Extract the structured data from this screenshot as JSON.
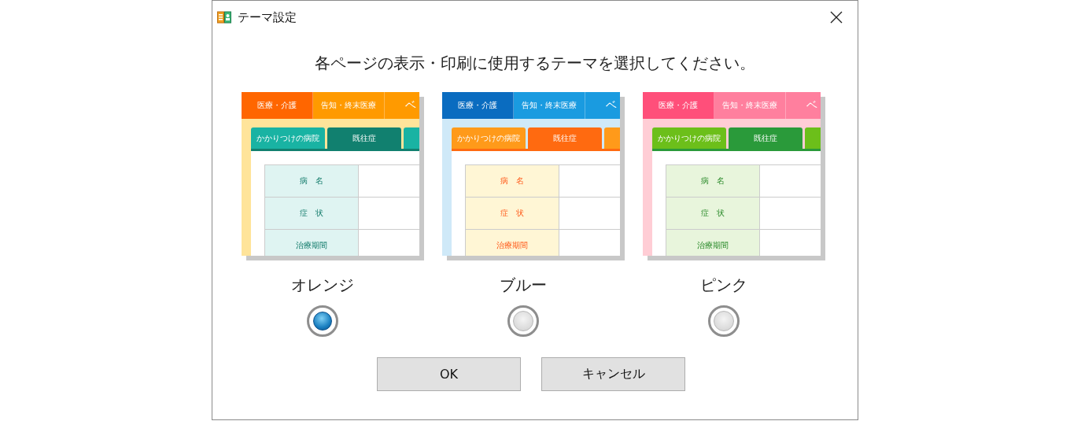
{
  "window": {
    "title": "テーマ設定"
  },
  "message": "各ページの表示・印刷に使用するテーマを選択してください。",
  "themes": [
    {
      "kind": "orange",
      "label": "オレンジ",
      "selected": true,
      "preview": {
        "top_tabs": [
          {
            "label": "医療・介護",
            "selected": true
          },
          {
            "label": "告知・終末医療",
            "selected": false
          },
          {
            "label": "ベ",
            "selected": false
          }
        ],
        "sub_tabs": [
          {
            "label": "かかりつけの病院",
            "selected": false
          },
          {
            "label": "既往症",
            "selected": true
          }
        ],
        "rows": [
          "病　名",
          "症　状",
          "治療期間"
        ]
      }
    },
    {
      "kind": "blue",
      "label": "ブルー",
      "selected": false,
      "preview": {
        "top_tabs": [
          {
            "label": "医療・介護",
            "selected": true
          },
          {
            "label": "告知・終末医療",
            "selected": false
          },
          {
            "label": "ベ",
            "selected": false
          }
        ],
        "sub_tabs": [
          {
            "label": "かかりつけの病院",
            "selected": false
          },
          {
            "label": "既往症",
            "selected": true
          }
        ],
        "rows": [
          "病　名",
          "症　状",
          "治療期間"
        ]
      }
    },
    {
      "kind": "pink",
      "label": "ピンク",
      "selected": false,
      "preview": {
        "top_tabs": [
          {
            "label": "医療・介護",
            "selected": true
          },
          {
            "label": "告知・終末医療",
            "selected": false
          },
          {
            "label": "ベ",
            "selected": false
          }
        ],
        "sub_tabs": [
          {
            "label": "かかりつけの病院",
            "selected": false
          },
          {
            "label": "既往症",
            "selected": true
          }
        ],
        "rows": [
          "病　名",
          "症　状",
          "治療期間"
        ]
      }
    }
  ],
  "buttons": [
    "OK",
    "キャンセル"
  ]
}
